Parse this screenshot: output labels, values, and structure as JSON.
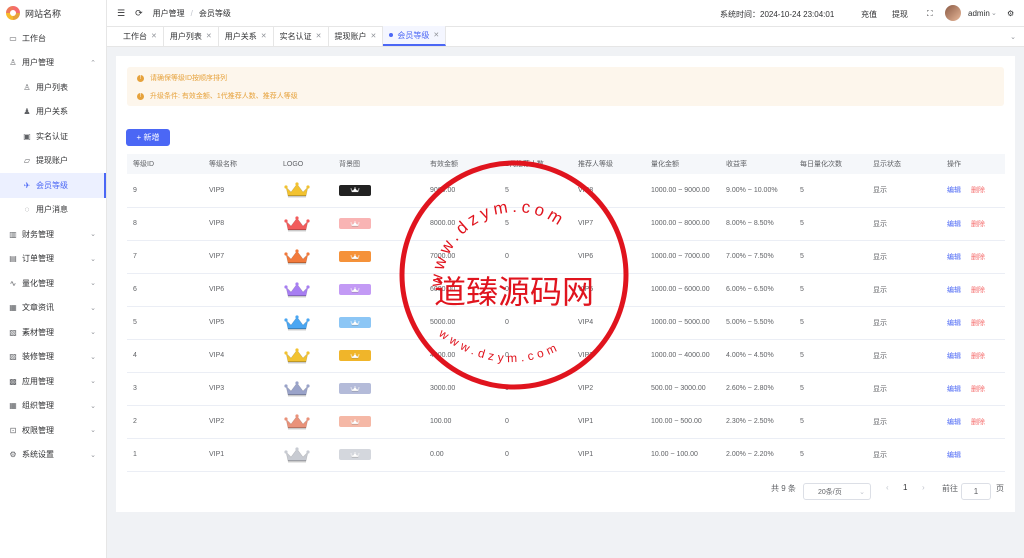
{
  "brand": {
    "name": "网站名称"
  },
  "sidebar": {
    "items": [
      {
        "label": "工作台",
        "icon": "monitor-icon",
        "level": 0
      },
      {
        "label": "用户管理",
        "icon": "user-icon",
        "level": 0,
        "expanded": true
      },
      {
        "label": "用户列表",
        "icon": "user-icon",
        "level": 1
      },
      {
        "label": "用户关系",
        "icon": "users-icon",
        "level": 1
      },
      {
        "label": "实名认证",
        "icon": "id-card-icon",
        "level": 1
      },
      {
        "label": "提现账户",
        "icon": "folder-icon",
        "level": 1
      },
      {
        "label": "会员等级",
        "icon": "pin-icon",
        "level": 1,
        "active": true
      },
      {
        "label": "用户消息",
        "icon": "chat-icon",
        "level": 1
      },
      {
        "label": "财务管理",
        "icon": "chart-icon",
        "level": 0
      },
      {
        "label": "订单管理",
        "icon": "document-icon",
        "level": 0
      },
      {
        "label": "量化管理",
        "icon": "pulse-icon",
        "level": 0
      },
      {
        "label": "文章资讯",
        "icon": "news-icon",
        "level": 0
      },
      {
        "label": "素材管理",
        "icon": "image-icon",
        "level": 0
      },
      {
        "label": "装修管理",
        "icon": "layout-icon",
        "level": 0
      },
      {
        "label": "应用管理",
        "icon": "apps-icon",
        "level": 0
      },
      {
        "label": "组织管理",
        "icon": "org-icon",
        "level": 0
      },
      {
        "label": "权限管理",
        "icon": "lock-icon",
        "level": 0
      },
      {
        "label": "系统设置",
        "icon": "gear-icon",
        "level": 0
      }
    ]
  },
  "header": {
    "breadcrumb": [
      "用户管理",
      "会员等级"
    ],
    "system_time": "系统时间：2024-10-24 23:04:01",
    "recharge": "充值",
    "withdraw": "提现",
    "user": "admin"
  },
  "tabs": [
    "工作台",
    "用户列表",
    "用户关系",
    "实名认证",
    "提现账户",
    "会员等级"
  ],
  "alert": {
    "line1": "请确保等级ID按顺序排列",
    "line2": "升级条件: 有效金额、1代推荐人数、推荐人等级"
  },
  "toolbar": {
    "add_label": "+ 新增"
  },
  "table": {
    "columns": [
      "等级ID",
      "等级名称",
      "LOGO",
      "背景图",
      "有效金额",
      "1代推荐人数",
      "推荐人等级",
      "量化金额",
      "收益率",
      "每日量化次数",
      "显示状态",
      "操作"
    ],
    "rows": [
      {
        "id": "9",
        "name": "VIP9",
        "logo": "#f2c230",
        "bg": "#222222",
        "amount": "9000.00",
        "ref": "5",
        "ref_level": "VIP8",
        "quant": "1000.00 ~ 9000.00",
        "rate": "9.00% ~ 10.00%",
        "daily": "5",
        "status": "显示",
        "edit": "编辑",
        "del": "删除"
      },
      {
        "id": "8",
        "name": "VIP8",
        "logo": "#f25c5c",
        "bg": "#f9b4b4",
        "amount": "8000.00",
        "ref": "5",
        "ref_level": "VIP7",
        "quant": "1000.00 ~ 8000.00",
        "rate": "8.00% ~ 8.50%",
        "daily": "5",
        "status": "显示",
        "edit": "编辑",
        "del": "删除"
      },
      {
        "id": "7",
        "name": "VIP7",
        "logo": "#f27a3c",
        "bg": "#f5923a",
        "amount": "7000.00",
        "ref": "0",
        "ref_level": "VIP6",
        "quant": "1000.00 ~ 7000.00",
        "rate": "7.00% ~ 7.50%",
        "daily": "5",
        "status": "显示",
        "edit": "编辑",
        "del": "删除"
      },
      {
        "id": "6",
        "name": "VIP6",
        "logo": "#a77ef2",
        "bg": "#c39af5",
        "amount": "6000.00",
        "ref": "0",
        "ref_level": "VIP5",
        "quant": "1000.00 ~ 6000.00",
        "rate": "6.00% ~ 6.50%",
        "daily": "5",
        "status": "显示",
        "edit": "编辑",
        "del": "删除"
      },
      {
        "id": "5",
        "name": "VIP5",
        "logo": "#4aa6f2",
        "bg": "#8cc6f5",
        "amount": "5000.00",
        "ref": "0",
        "ref_level": "VIP4",
        "quant": "1000.00 ~ 5000.00",
        "rate": "5.00% ~ 5.50%",
        "daily": "5",
        "status": "显示",
        "edit": "编辑",
        "del": "删除"
      },
      {
        "id": "4",
        "name": "VIP4",
        "logo": "#f2c230",
        "bg": "#f0b52a",
        "amount": "4000.00",
        "ref": "0",
        "ref_level": "VIP3",
        "quant": "1000.00 ~ 4000.00",
        "rate": "4.00% ~ 4.50%",
        "daily": "5",
        "status": "显示",
        "edit": "编辑",
        "del": "删除"
      },
      {
        "id": "3",
        "name": "VIP3",
        "logo": "#9aa3c9",
        "bg": "#b4bbd9",
        "amount": "3000.00",
        "ref": "0",
        "ref_level": "VIP2",
        "quant": "500.00 ~ 3000.00",
        "rate": "2.60% ~ 2.80%",
        "daily": "5",
        "status": "显示",
        "edit": "编辑",
        "del": "删除"
      },
      {
        "id": "2",
        "name": "VIP2",
        "logo": "#e9927a",
        "bg": "#f5b8a6",
        "amount": "100.00",
        "ref": "0",
        "ref_level": "VIP1",
        "quant": "100.00 ~ 500.00",
        "rate": "2.30% ~ 2.50%",
        "daily": "5",
        "status": "显示",
        "edit": "编辑",
        "del": "删除"
      },
      {
        "id": "1",
        "name": "VIP1",
        "logo": "#c8cbd2",
        "bg": "#d4d7dd",
        "amount": "0.00",
        "ref": "0",
        "ref_level": "VIP1",
        "quant": "10.00 ~ 100.00",
        "rate": "2.00% ~ 2.20%",
        "daily": "5",
        "status": "显示",
        "edit": "编辑",
        "del": ""
      }
    ]
  },
  "pagination": {
    "total": "共 9 条",
    "page_size": "20条/页",
    "current": "1",
    "goto": "前往",
    "goto_value": "1",
    "page_unit": "页"
  },
  "watermark": {
    "text": "道臻源码网",
    "url_top": "www.dzym.com",
    "url_bottom": "www.dzym.com"
  }
}
